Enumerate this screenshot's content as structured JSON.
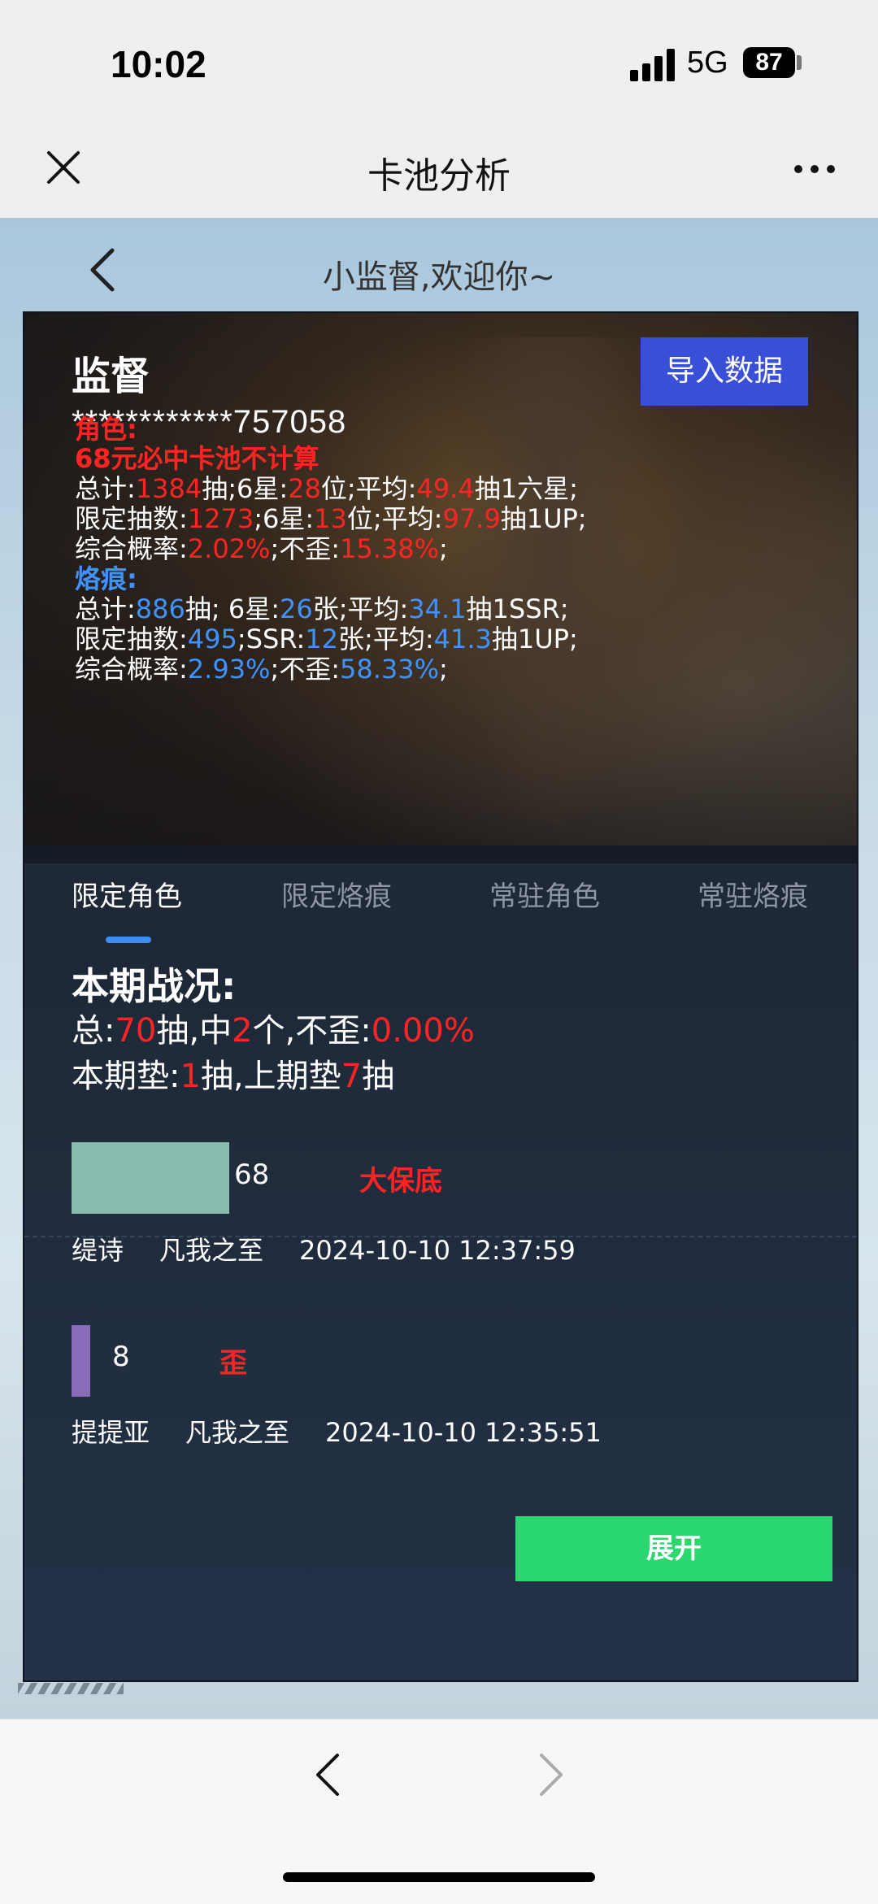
{
  "status": {
    "time": "10:02",
    "network": "5G",
    "battery": "87"
  },
  "nav": {
    "title": "卡池分析"
  },
  "web": {
    "welcome": "小监督,欢迎你~"
  },
  "profile": {
    "name": "监督",
    "id": "************757058",
    "import_label": "导入数据"
  },
  "role": {
    "heading": "角色:",
    "note": "68元必中卡池不计算",
    "l1": {
      "a": "总计:",
      "b": "1384",
      "c": "抽;6星:",
      "d": "28",
      "e": "位;平均:",
      "f": "49.4",
      "g": "抽1六星;"
    },
    "l2": {
      "a": "限定抽数:",
      "b": "1273",
      "c": ";6星:",
      "d": "13",
      "e": "位;平均:",
      "f": "97.9",
      "g": "抽1UP;"
    },
    "l3": {
      "a": "综合概率:",
      "b": "2.02%",
      "c": ";不歪:",
      "d": "15.38%",
      "e": ";"
    }
  },
  "brand": {
    "heading": "烙痕:",
    "l1": {
      "a": "总计:",
      "b": "886",
      "c": "抽; 6星:",
      "d": "26",
      "e": "张;平均:",
      "f": "34.1",
      "g": "抽1SSR;"
    },
    "l2": {
      "a": "限定抽数:",
      "b": "495",
      "c": ";SSR:",
      "d": "12",
      "e": "张;平均:",
      "f": "41.3",
      "g": "抽1UP;"
    },
    "l3": {
      "a": "综合概率:",
      "b": "2.93%",
      "c": ";不歪:",
      "d": "58.33%",
      "e": ";"
    }
  },
  "tabs": [
    "限定角色",
    "限定烙痕",
    "常驻角色",
    "常驻烙痕"
  ],
  "current": {
    "title": "本期战况:",
    "s1": {
      "a": "总:",
      "b": "70",
      "c": "抽,中",
      "d": "2",
      "e": "个,不歪:",
      "f": "0.00%"
    },
    "s2": {
      "a": "本期垫:",
      "b": "1",
      "c": "抽,上期垫",
      "d": "7",
      "e": "抽"
    }
  },
  "records": [
    {
      "count": "68",
      "tag": "大保底",
      "character": "缇诗",
      "pool": "凡我之至",
      "time": "2024-10-10 12:37:59",
      "color": "#86bbad",
      "fill": 68
    },
    {
      "count": "8",
      "tag": "歪",
      "character": "提提亚",
      "pool": "凡我之至",
      "time": "2024-10-10 12:35:51",
      "color": "#8a6bb8",
      "fill": 8
    }
  ],
  "expand_label": "展开"
}
